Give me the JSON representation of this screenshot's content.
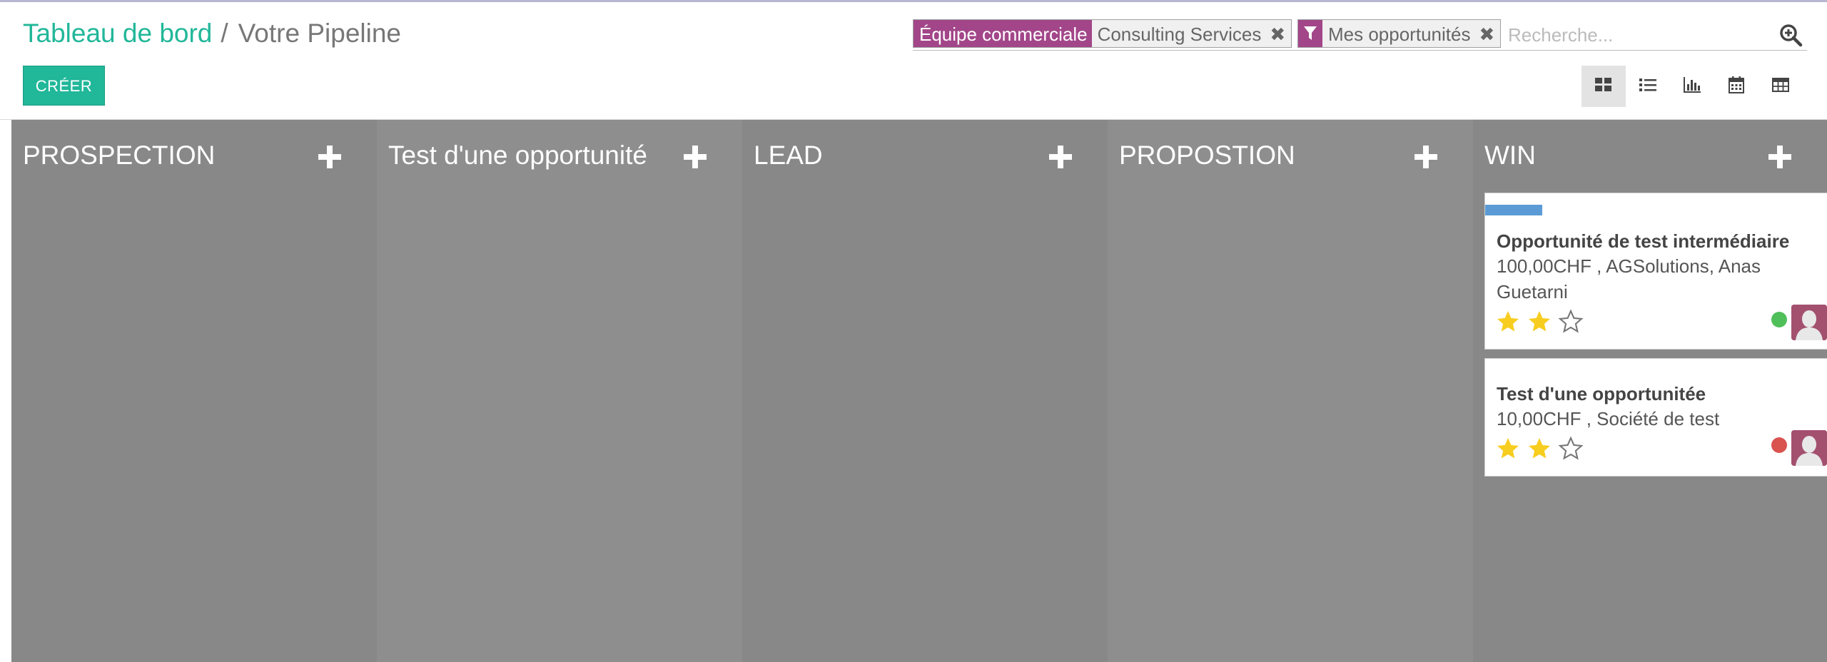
{
  "breadcrumb": {
    "parent": "Tableau de bord",
    "separator": "/",
    "current": "Votre Pipeline"
  },
  "toolbar": {
    "create_label": "CRÉER"
  },
  "search": {
    "facets": [
      {
        "label": "Équipe commerciale",
        "value": "Consulting Services",
        "remove": "✖"
      },
      {
        "icon": "filter-icon",
        "value": "Mes opportunités",
        "remove": "✖"
      }
    ],
    "placeholder": "Recherche..."
  },
  "views": [
    {
      "name": "kanban-view-icon",
      "active": true
    },
    {
      "name": "list-view-icon",
      "active": false
    },
    {
      "name": "graph-view-icon",
      "active": false
    },
    {
      "name": "calendar-view-icon",
      "active": false
    },
    {
      "name": "pivot-view-icon",
      "active": false
    }
  ],
  "colors": {
    "brand_green": "#21b799",
    "facet_purple": "#a24689",
    "column_odd": "#888888",
    "column_even": "#8e8e8e",
    "card_tag": "#5b9bd5",
    "star_on": "#f7cd1f",
    "status_green": "#4fbf5a",
    "status_red": "#d9534f"
  },
  "columns": [
    {
      "title": "PROSPECTION",
      "cards": []
    },
    {
      "title": "Test d'une opportunité",
      "cards": []
    },
    {
      "title": "LEAD",
      "cards": []
    },
    {
      "title": "PROPOSTION",
      "cards": []
    },
    {
      "title": "WIN",
      "cards": [
        {
          "title": "Opportunité de test intermédiaire",
          "info": "100,00CHF , AGSolutions, Anas Guetarni",
          "stars": 2,
          "max_stars": 3,
          "status": "green"
        },
        {
          "title": "Test d'une opportunitée",
          "info": "10,00CHF , Société de test",
          "stars": 2,
          "max_stars": 3,
          "status": "red"
        }
      ]
    }
  ]
}
